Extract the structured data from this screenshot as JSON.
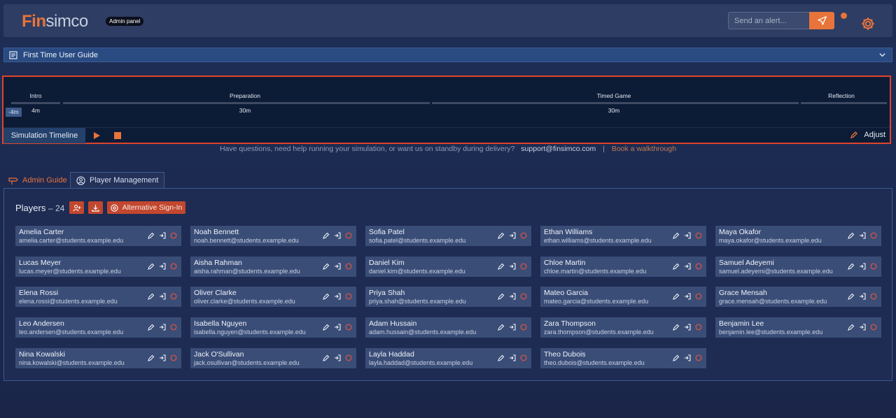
{
  "header": {
    "logo_accent": "Fin",
    "logo_rest": "simco",
    "badge": "Admin panel",
    "alert_placeholder": "Send an alert..."
  },
  "guide_bar": {
    "label": "First Time User Guide"
  },
  "timeline": {
    "phases": [
      {
        "name": "Intro",
        "duration": "4m"
      },
      {
        "name": "Preparation",
        "duration": "30m"
      },
      {
        "name": "Timed Game",
        "duration": "30m"
      },
      {
        "name": "Reflection",
        "duration": ""
      }
    ],
    "offset_badge": "-4m",
    "footer_label": "Simulation Timeline",
    "adjust_label": "Adjust"
  },
  "help": {
    "text": "Have questions, need help running your simulation, or want us on standby during delivery?",
    "email": "support@finsimco.com",
    "separator": "|",
    "walkthrough": "Book a walkthrough"
  },
  "tabs": [
    {
      "label": "Admin Guide"
    },
    {
      "label": "Player Management"
    }
  ],
  "players_panel": {
    "title": "Players",
    "count": "– 24",
    "alt_signin_label": "Alternative Sign-In",
    "players": [
      {
        "name": "Amelia Carter",
        "email": "amelia.carter@students.example.edu"
      },
      {
        "name": "Noah Bennett",
        "email": "noah.bennett@students.example.edu"
      },
      {
        "name": "Sofia Patel",
        "email": "sofia.patel@students.example.edu"
      },
      {
        "name": "Ethan Williams",
        "email": "ethan.williams@students.example.edu"
      },
      {
        "name": "Maya Okafor",
        "email": "maya.okafor@students.example.edu"
      },
      {
        "name": "Lucas Meyer",
        "email": "lucas.meyer@students.example.edu"
      },
      {
        "name": "Aisha Rahman",
        "email": "aisha.rahman@students.example.edu"
      },
      {
        "name": "Daniel Kim",
        "email": "daniel.kim@students.example.edu"
      },
      {
        "name": "Chloe Martin",
        "email": "chloe.martin@students.example.edu"
      },
      {
        "name": "Samuel Adeyemi",
        "email": "samuel.adeyemi@students.example.edu"
      },
      {
        "name": "Elena Rossi",
        "email": "elena.rossi@students.example.edu"
      },
      {
        "name": "Oliver Clarke",
        "email": "oliver.clarke@students.example.edu"
      },
      {
        "name": "Priya Shah",
        "email": "priya.shah@students.example.edu"
      },
      {
        "name": "Mateo Garcia",
        "email": "mateo.garcia@students.example.edu"
      },
      {
        "name": "Grace Mensah",
        "email": "grace.mensah@students.example.edu"
      },
      {
        "name": "Leo Andersen",
        "email": "leo.andersen@students.example.edu"
      },
      {
        "name": "Isabella Nguyen",
        "email": "isabella.nguyen@students.example.edu"
      },
      {
        "name": "Adam Hussain",
        "email": "adam.hussain@students.example.edu"
      },
      {
        "name": "Zara Thompson",
        "email": "zara.thompson@students.example.edu"
      },
      {
        "name": "Benjamin Lee",
        "email": "benjamin.lee@students.example.edu"
      },
      {
        "name": "Nina Kowalski",
        "email": "nina.kowalski@students.example.edu"
      },
      {
        "name": "Jack O'Sullivan",
        "email": "jack.osullivan@students.example.edu"
      },
      {
        "name": "Layla Haddad",
        "email": "layla.haddad@students.example.edu"
      },
      {
        "name": "Theo Dubois",
        "email": "theo.dubois@students.example.edu"
      }
    ]
  },
  "colors": {
    "accent": "#e8743b",
    "highlight_border": "#e0442c",
    "card_bg": "#3a4d77"
  }
}
